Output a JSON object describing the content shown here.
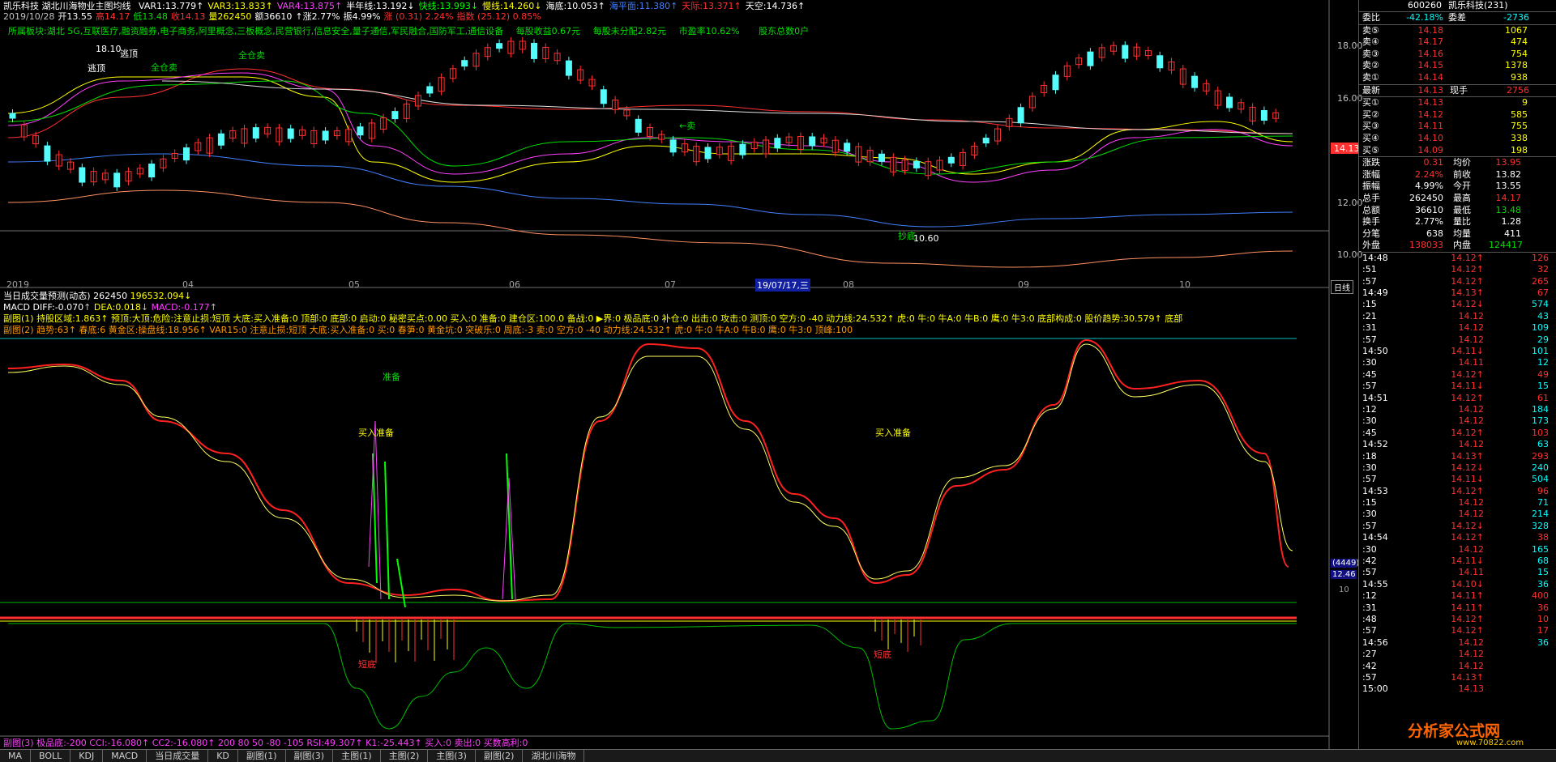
{
  "header": {
    "stock_name": "凯乐科技",
    "indicator_name": "湖北川海物业主图均线",
    "vars": [
      {
        "label": "VAR1:13.779",
        "arrow": "↑",
        "color": "#ffffff"
      },
      {
        "label": "VAR3:13.833",
        "arrow": "↑",
        "color": "#ffff00"
      },
      {
        "label": "VAR4:13.875",
        "arrow": "↑",
        "color": "#ff40ff"
      },
      {
        "label": "半年线:13.192",
        "arrow": "↓",
        "color": "#ffffff"
      },
      {
        "label": "快线:13.993",
        "arrow": "↓",
        "color": "#00ff00"
      },
      {
        "label": "慢线:14.260",
        "arrow": "↓",
        "color": "#ffff00"
      },
      {
        "label": "海底:10.053",
        "arrow": "↑",
        "color": "#ffffff"
      },
      {
        "label": "海平面:11.380",
        "arrow": "↑",
        "color": "#4080ff"
      },
      {
        "label": "天际:13.371",
        "arrow": "↑",
        "color": "#ff3030"
      },
      {
        "label": "天空:14.736",
        "arrow": "↑",
        "color": "#ffffff"
      }
    ],
    "date_line": [
      {
        "text": "2019/10/28",
        "color": "#c0c0c0"
      },
      {
        "text": "开13.55",
        "color": "#ffffff"
      },
      {
        "text": "高14.17",
        "color": "#ff3030"
      },
      {
        "text": "低13.48",
        "color": "#00e000"
      },
      {
        "text": "收14.13",
        "color": "#ff3030"
      },
      {
        "text": "量262450",
        "color": "#ffff00"
      },
      {
        "text": "额36610",
        "color": "#ffffff"
      },
      {
        "text": "↑涨2.77%",
        "color": "#ffffff"
      },
      {
        "text": "振4.99%",
        "color": "#ffffff"
      },
      {
        "text": "涨 (0.31) 2.24%",
        "color": "#ff3030"
      },
      {
        "text": "指数 (25.12) 0.85%",
        "color": "#ff3030"
      }
    ],
    "sector": "所属板块:湖北 5G,互联医疗,融资融券,电子商务,阿里概念,三板概念,民营银行,信息安全,量子通信,军民融合,国防军工,通信设备",
    "eps": "每股收益0.67元",
    "undist": "每股未分配2.82元",
    "pe": "市盈率10.62%",
    "shares": "股东总数0户"
  },
  "main_chart": {
    "y_ticks": [
      "18.00",
      "16.00",
      "14.00",
      "12.00",
      "10.00"
    ],
    "current_price": "14.13",
    "annotations": [
      "18.10",
      "逃顶",
      "逃顶",
      "全仓卖",
      "全仓卖",
      "←卖",
      "抄底",
      "10.60"
    ],
    "x_labels": [
      "2019",
      "04",
      "05",
      "06",
      "07",
      "19/07/17,三",
      "08",
      "09",
      "10"
    ],
    "x_axis_btn": "日线"
  },
  "vol_line": {
    "text": "当日成交量预测(动态)",
    "v1": "262450",
    "v2": "196532.094",
    "arrow": "↓"
  },
  "macd_line": {
    "prefix": "MACD",
    "diff": "DIFF:-0.070",
    "dea": "DEA:0.018",
    "macd": "MACD:-0.177"
  },
  "sub1_line": "副图(1) 持股区域:1.863↑ 预顶:大顶:危险:注意止损:短顶 大底:买入准备:0 顶部:0 底部:0 启动:0 秘密买点:0.00 买入:0 准备:0 建仓区:100.0 备战:0 ▶界:0 极品底:0 补仓:0 出击:0 攻击:0 测顶:0 空方:0 -40 动力线:24.532↑ 虎:0 牛:0 牛A:0 牛B:0 鹰:0 牛3:0 底部构成:0 股价趋势:30.579↑ 底部",
  "sub2_line": "副图(2) 趋势:63↑ 春底:6 黄金区:操盘线:18.956↑ VAR15:0 注意止损:短顶 大底:买入准备:0 买:0 春笋:0 黄金坑:0 突破乐:0 周底:-3 卖:0 空方:0 -40 动力线:24.532↑ 虎:0 牛:0 牛A:0 牛B:0 鹰:0 牛3:0 顶峰:100",
  "sub2_annotations": [
    "准备",
    "买入准备",
    "买入准备",
    "短底",
    "短底"
  ],
  "sub2_right": {
    "count": "(4449)",
    "val": "12.46",
    "tick": "10"
  },
  "sub3_line": "副图(3) 极品底:-200 CCI:-16.080↑ CC2:-16.080↑ 200 80 50 -80 -105 RSI:49.307↑ K1:-25.443↑ 买入:0 卖出:0 买数高利:0",
  "side": {
    "code": "600260",
    "name": "凯乐科技(231)",
    "wb_label": "委比",
    "wb_val": "-42.18%",
    "wc_label": "委差",
    "wc_val": "-2736",
    "asks": [
      {
        "l": "卖⑤",
        "p": "14.18",
        "v": "1067"
      },
      {
        "l": "卖④",
        "p": "14.17",
        "v": "474"
      },
      {
        "l": "卖③",
        "p": "14.16",
        "v": "754"
      },
      {
        "l": "卖②",
        "p": "14.15",
        "v": "1378"
      },
      {
        "l": "卖①",
        "p": "14.14",
        "v": "938"
      }
    ],
    "last": {
      "l": "最新",
      "p": "14.13",
      "l2": "现手",
      "v": "2756"
    },
    "bids": [
      {
        "l": "买①",
        "p": "14.13",
        "v": "9"
      },
      {
        "l": "买②",
        "p": "14.12",
        "v": "585"
      },
      {
        "l": "买③",
        "p": "14.11",
        "v": "755"
      },
      {
        "l": "买④",
        "p": "14.10",
        "v": "338"
      },
      {
        "l": "买⑤",
        "p": "14.09",
        "v": "198"
      }
    ],
    "stats": [
      {
        "l": "涨跌",
        "v": "0.31",
        "l2": "均价",
        "v2": "13.95"
      },
      {
        "l": "涨幅",
        "v": "2.24%",
        "l2": "前收",
        "v2": "13.82"
      },
      {
        "l": "振幅",
        "v": "4.99%",
        "l2": "今开",
        "v2": "13.55"
      },
      {
        "l": "总手",
        "v": "262450",
        "l2": "最高",
        "v2": "14.17"
      },
      {
        "l": "总额",
        "v": "36610",
        "l2": "最低",
        "v2": "13.48"
      },
      {
        "l": "换手",
        "v": "2.77%",
        "l2": "量比",
        "v2": "1.28"
      },
      {
        "l": "分笔",
        "v": "638",
        "l2": "均量",
        "v2": "411"
      },
      {
        "l": "外盘",
        "v": "138033",
        "l2": "内盘",
        "v2": "124417"
      }
    ],
    "ticks": [
      {
        "t": "14:48",
        "p": "14.12",
        "a": "↑",
        "v": "126",
        "c": "#ff3030"
      },
      {
        "t": ":51",
        "p": "14.12",
        "a": "↑",
        "v": "32",
        "c": "#ff3030"
      },
      {
        "t": ":57",
        "p": "14.12",
        "a": "↑",
        "v": "265",
        "c": "#ff3030"
      },
      {
        "t": "14:49",
        "p": "14.13",
        "a": "↑",
        "v": "67",
        "c": "#ff3030"
      },
      {
        "t": ":15",
        "p": "14.12",
        "a": "↓",
        "v": "574",
        "c": "#00ffff"
      },
      {
        "t": ":21",
        "p": "14.12",
        "a": "",
        "v": "43",
        "c": "#00ffff"
      },
      {
        "t": ":31",
        "p": "14.12",
        "a": "",
        "v": "109",
        "c": "#00ffff"
      },
      {
        "t": ":57",
        "p": "14.12",
        "a": "",
        "v": "29",
        "c": "#00ffff"
      },
      {
        "t": "14:50",
        "p": "14.11",
        "a": "↓",
        "v": "101",
        "c": "#00ffff"
      },
      {
        "t": ":30",
        "p": "14.11",
        "a": "",
        "v": "12",
        "c": "#00ffff"
      },
      {
        "t": ":45",
        "p": "14.12",
        "a": "↑",
        "v": "49",
        "c": "#ff3030"
      },
      {
        "t": ":57",
        "p": "14.11",
        "a": "↓",
        "v": "15",
        "c": "#00ffff"
      },
      {
        "t": "14:51",
        "p": "14.12",
        "a": "↑",
        "v": "61",
        "c": "#ff3030"
      },
      {
        "t": ":12",
        "p": "14.12",
        "a": "",
        "v": "184",
        "c": "#00ffff"
      },
      {
        "t": ":30",
        "p": "14.12",
        "a": "",
        "v": "173",
        "c": "#00ffff"
      },
      {
        "t": ":45",
        "p": "14.12",
        "a": "↑",
        "v": "103",
        "c": "#ff3030"
      },
      {
        "t": "14:52",
        "p": "14.12",
        "a": "",
        "v": "63",
        "c": "#00ffff"
      },
      {
        "t": ":18",
        "p": "14.13",
        "a": "↑",
        "v": "293",
        "c": "#ff3030"
      },
      {
        "t": ":30",
        "p": "14.12",
        "a": "↓",
        "v": "240",
        "c": "#00ffff"
      },
      {
        "t": ":57",
        "p": "14.11",
        "a": "↓",
        "v": "504",
        "c": "#00ffff"
      },
      {
        "t": "14:53",
        "p": "14.12",
        "a": "↑",
        "v": "96",
        "c": "#ff3030"
      },
      {
        "t": ":15",
        "p": "14.12",
        "a": "",
        "v": "71",
        "c": "#00ffff"
      },
      {
        "t": ":30",
        "p": "14.12",
        "a": "",
        "v": "214",
        "c": "#00ffff"
      },
      {
        "t": ":57",
        "p": "14.12",
        "a": "↓",
        "v": "328",
        "c": "#00ffff"
      },
      {
        "t": "14:54",
        "p": "14.12",
        "a": "↑",
        "v": "38",
        "c": "#ff3030"
      },
      {
        "t": ":30",
        "p": "14.12",
        "a": "",
        "v": "165",
        "c": "#00ffff"
      },
      {
        "t": ":42",
        "p": "14.11",
        "a": "↓",
        "v": "68",
        "c": "#00ffff"
      },
      {
        "t": ":57",
        "p": "14.11",
        "a": "",
        "v": "15",
        "c": "#00ffff"
      },
      {
        "t": "14:55",
        "p": "14.10",
        "a": "↓",
        "v": "36",
        "c": "#00ffff"
      },
      {
        "t": ":12",
        "p": "14.11",
        "a": "↑",
        "v": "400",
        "c": "#ff3030"
      },
      {
        "t": ":31",
        "p": "14.11",
        "a": "↑",
        "v": "36",
        "c": "#ff3030"
      },
      {
        "t": ":48",
        "p": "14.12",
        "a": "↑",
        "v": "10",
        "c": "#ff3030"
      },
      {
        "t": ":57",
        "p": "14.12",
        "a": "↑",
        "v": "17",
        "c": "#ff3030"
      },
      {
        "t": "14:56",
        "p": "14.12",
        "a": "",
        "v": "36",
        "c": "#00ffff"
      },
      {
        "t": ":27",
        "p": "14.12",
        "a": "",
        "v": "",
        "c": "#00ffff"
      },
      {
        "t": ":42",
        "p": "14.12",
        "a": "",
        "v": "",
        "c": "#00ffff"
      },
      {
        "t": ":57",
        "p": "14.13",
        "a": "↑",
        "v": "",
        "c": "#ff3030"
      },
      {
        "t": "15:00",
        "p": "14.13",
        "a": "",
        "v": "",
        "c": "#ff3030"
      }
    ],
    "watermark": "分析家公式网",
    "watermark_url": "www.70822.com"
  },
  "tabs": [
    "MA",
    "BOLL",
    "KDJ",
    "MACD",
    "当日成交量",
    "KD",
    "副图(1)",
    "副图(3)",
    "主图(1)",
    "主图(2)",
    "主图(3)",
    "副图(2)",
    "湖北川海物"
  ]
}
